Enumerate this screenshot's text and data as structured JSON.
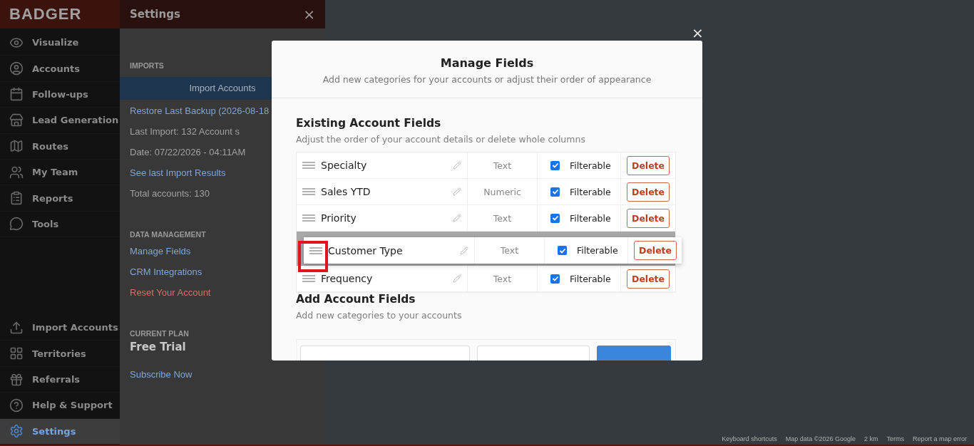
{
  "app": {
    "logo": "BADGER"
  },
  "sidebar": {
    "items": [
      {
        "label": "Visualize",
        "selected": false
      },
      {
        "label": "Accounts",
        "selected": false
      },
      {
        "label": "Follow-ups",
        "selected": false
      },
      {
        "label": "Lead Generation",
        "selected": false
      },
      {
        "label": "Routes",
        "selected": false
      },
      {
        "label": "My Team",
        "selected": false
      },
      {
        "label": "Reports",
        "selected": false
      },
      {
        "label": "Tools",
        "selected": false
      },
      {
        "label": "Import Accounts",
        "selected": false
      },
      {
        "label": "Territories",
        "selected": false
      },
      {
        "label": "Referrals",
        "selected": false
      },
      {
        "label": "Help & Support",
        "selected": false
      },
      {
        "label": "Settings",
        "selected": true
      }
    ]
  },
  "settings_panel": {
    "title": "Settings",
    "close": "×",
    "sections": [
      {
        "heading": "IMPORTS",
        "items": [
          {
            "kind": "button",
            "text": "Import Accounts"
          },
          {
            "kind": "link",
            "text": "Restore Last Backup (2026-08-18"
          },
          {
            "kind": "info",
            "text": "Last Import: 132 Account s"
          },
          {
            "kind": "info",
            "text": "Date: 07/22/2026 - 04:11AM"
          },
          {
            "kind": "link",
            "text": "See last Import Results"
          },
          {
            "kind": "info",
            "text": "Total accounts: 130"
          }
        ]
      },
      {
        "heading": "DATA MANAGEMENT",
        "items": [
          {
            "kind": "link",
            "text": "Manage Fields"
          },
          {
            "kind": "link",
            "text": "CRM Integrations"
          },
          {
            "kind": "danger",
            "text": "Reset Your Account"
          }
        ]
      },
      {
        "heading": "CURRENT PLAN",
        "items": [
          {
            "kind": "plan",
            "text": "Free Trial"
          },
          {
            "kind": "link",
            "text": "Subscribe Now"
          }
        ]
      }
    ]
  },
  "map": {
    "footer": [
      "Keyboard shortcuts",
      "Map data ©2026 Google",
      "2 km",
      "Terms",
      "Report a map error"
    ]
  },
  "modal": {
    "close": "×",
    "title": "Manage Fields",
    "subtitle": "Add new categories for your accounts or adjust their order of appearance",
    "existing": {
      "heading": "Existing Account Fields",
      "description": "Adjust the order of your account details or delete whole columns",
      "fields": [
        {
          "name": "Specialty",
          "type": "Text",
          "filterable_label": "Filterable",
          "checked": true,
          "delete": "Delete",
          "dragging": false
        },
        {
          "name": "Sales YTD",
          "type": "Numeric",
          "filterable_label": "Filterable",
          "checked": true,
          "delete": "Delete",
          "dragging": false
        },
        {
          "name": "Priority",
          "type": "Text",
          "filterable_label": "Filterable",
          "checked": true,
          "delete": "Delete",
          "dragging": false
        },
        {
          "name": "Customer Type",
          "type": "Text",
          "filterable_label": "Filterable",
          "checked": true,
          "delete": "Delete",
          "dragging": true
        },
        {
          "name": "Frequency",
          "type": "Text",
          "filterable_label": "Filterable",
          "checked": true,
          "delete": "Delete",
          "dragging": false
        }
      ]
    },
    "add": {
      "heading": "Add Account Fields",
      "description": "Add new categories to your accounts"
    }
  }
}
